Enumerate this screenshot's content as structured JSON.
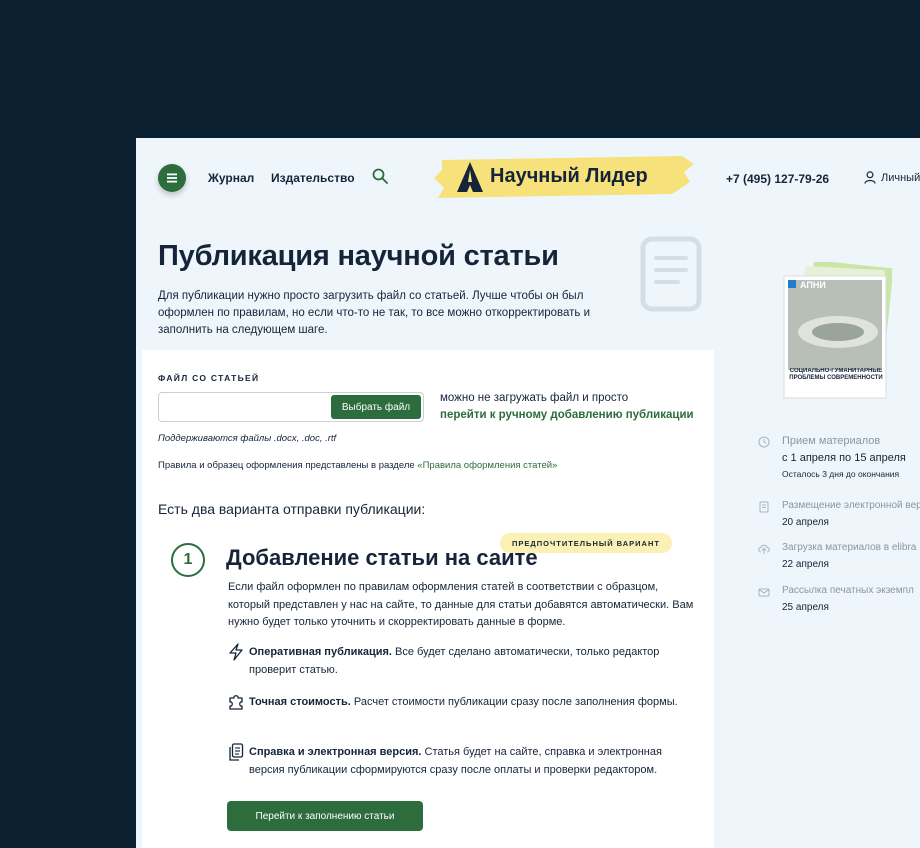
{
  "header": {
    "nav": [
      "Журнал",
      "Издательство"
    ],
    "logo_text": "Научный Лидер",
    "phone": "+7 (495) 127-79-26",
    "account_label": "Личный"
  },
  "main": {
    "title": "Публикация научной статьи",
    "intro": "Для публикации нужно просто загрузить файл со статьей. Лучше чтобы он был оформлен по правилам, но если что-то не так, то все можно откорректировать и заполнить на следующем шаге.",
    "file_section_label": "ФАЙЛ СО СТАТЬЕЙ",
    "file_button": "Выбрать файл",
    "alt_text": "можно не загружать файл и просто",
    "alt_link": "перейти к ручному добавлению публикации",
    "formats": "Поддерживаются файлы .docx, .doc, .rtf",
    "rules_text": "Правила и образец оформления представлены в разделе ",
    "rules_link": "«Правила оформления статей»",
    "variants_title": "Есть два варианта отправки публикации:",
    "badge": "ПРЕДПОЧТИТЕЛЬНЫЙ ВАРИАНТ",
    "option_number": "1",
    "option_title": "Добавление статьи на сайте",
    "option_desc": "Если файл оформлен по правилам оформления статей в соответствии с образцом, который представлен у нас на сайте, то данные для статьи добавятся автоматически. Вам нужно будет только уточнить и скорректировать данные в форме.",
    "features": [
      {
        "icon": "lightning-icon",
        "bold": "Оперативная публикация.",
        "text": " Все будет сделано автоматически, только редактор проверит статью."
      },
      {
        "icon": "puzzle-icon",
        "bold": "Точная стоимость.",
        "text": " Расчет стоимости публикации сразу после заполнения формы."
      },
      {
        "icon": "documents-icon",
        "bold": "Справка и электронная версия.",
        "text": " Статья будет на сайте, справка и электронная версия публикации сформируются сразу после оплаты и проверки редактором."
      }
    ],
    "cta": "Перейти к заполнению статьи"
  },
  "sidebar": {
    "book_brand": "АПНИ",
    "book_title": "СОЦИАЛЬНО-ГУМАНИТАРНЫЕ ПРОБЛЕМЫ СОВРЕМЕННОСТИ",
    "timeline": [
      {
        "icon": "clock-icon",
        "title": "Прием материалов",
        "date": "с 1 апреля по 15 апреля",
        "note": "Осталось 3 дня до окончания"
      },
      {
        "icon": "document-icon",
        "title": "Размещение электронной вер",
        "date": "20 апреля"
      },
      {
        "icon": "upload-icon",
        "title": "Загрузка материалов в elibra",
        "date": "22 апреля"
      },
      {
        "icon": "mail-icon",
        "title": "Рассылка печатных экземпл",
        "date": "25 апреля"
      }
    ]
  },
  "colors": {
    "accent": "#2d6c3d",
    "logo_bg": "#f7e17a",
    "frame_bg": "#0b2132",
    "page_bg": "#eef6fb"
  }
}
